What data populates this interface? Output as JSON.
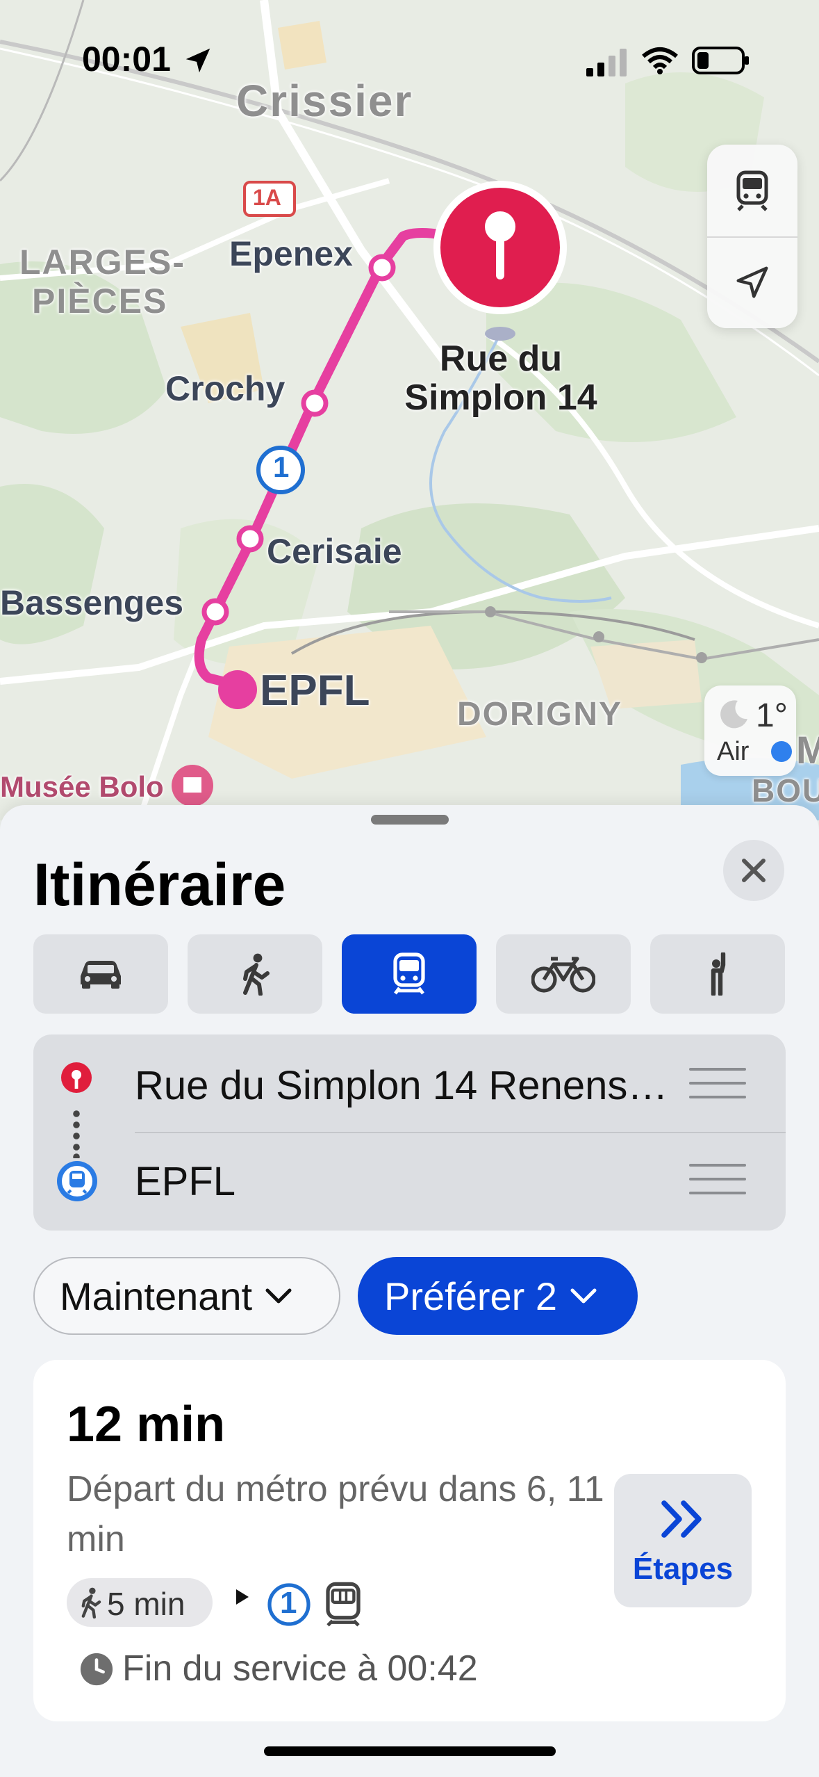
{
  "status_bar": {
    "time": "00:01",
    "icons": [
      "location-arrow-icon",
      "cellular-signal-icon",
      "wifi-icon",
      "battery-icon"
    ]
  },
  "map": {
    "labels": {
      "town_crissier": "Crissier",
      "town_larges_pieces_1": "LARGES-",
      "town_larges_pieces_2": "PIÈCES",
      "town_dorigny": "DORIGNY",
      "road_badge": "1A",
      "stop_epenex": "Epenex",
      "stop_crochy": "Crochy",
      "stop_cerisaie": "Cerisaie",
      "stop_bassenges": "Bassenges",
      "stop_epfl": "EPFL",
      "destination_line1": "Rue du",
      "destination_line2": "Simplon 14",
      "museum": "Musée Bolo",
      "line_number": "1",
      "edge_m": "M",
      "edge_bou": "BOU"
    },
    "route_color": "#e63fa0",
    "weather": {
      "temp": "1°",
      "air": "Air"
    },
    "controls": [
      "transit-icon",
      "location-arrow-icon"
    ]
  },
  "sheet": {
    "title": "Itinéraire",
    "modes": [
      {
        "icon": "car-icon",
        "active": false
      },
      {
        "icon": "walk-icon",
        "active": false
      },
      {
        "icon": "transit-icon",
        "active": true
      },
      {
        "icon": "bike-icon",
        "active": false
      },
      {
        "icon": "hail-icon",
        "active": false
      }
    ],
    "route": {
      "origin": "Rue du Simplon 14 Renens…",
      "destination": "EPFL"
    },
    "filters": {
      "time": "Maintenant",
      "prefer": "Préférer 2"
    },
    "result": {
      "duration": "12 min",
      "description": "Départ du métro prévu dans 6, 11 min",
      "walk": "5 min",
      "line": "1",
      "steps_label": "Étapes",
      "service_end": "Fin du service à 00:42"
    }
  },
  "colors": {
    "accent": "#0a45d6",
    "route": "#e63fa0",
    "pin": "#e01e4f"
  }
}
